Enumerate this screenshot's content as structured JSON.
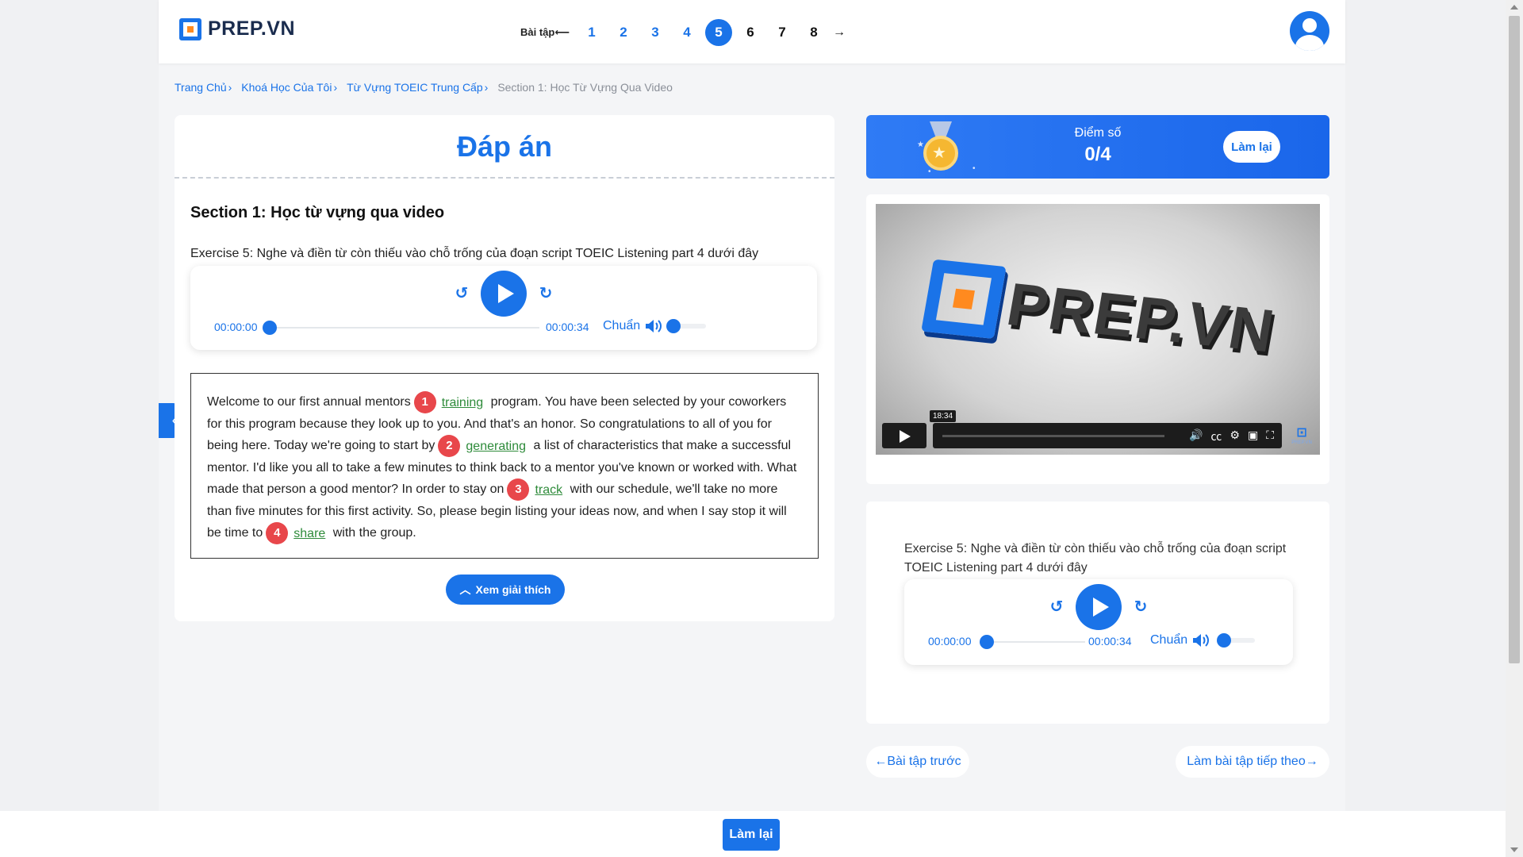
{
  "header": {
    "logo_text": "PREP.VN",
    "pager_label": "Bài tập",
    "pager_numbers": [
      "1",
      "2",
      "3",
      "4",
      "5",
      "6",
      "7",
      "8"
    ],
    "pager_arrow": "→"
  },
  "breadcrumb": {
    "items": [
      "Trang Chủ",
      "Khoá Học Của Tôi",
      "Từ Vựng TOEIC Trung Cấp"
    ],
    "current": "Section 1: Học Từ Vựng Qua Video"
  },
  "main": {
    "answer_title": "Đáp án",
    "section_title": "Section 1: Học từ vựng qua video",
    "exercise_instruction": "Exercise 5: Nghe và điền từ còn thiếu vào chỗ trống của đoạn script TOEIC Listening part 4 dưới đây",
    "audio": {
      "current_time": "00:00:00",
      "duration": "00:00:34",
      "speed": "Chuẩn"
    },
    "passage": {
      "p1": "Welcome to our first annual mentors",
      "p2": "program. You have been selected by your coworkers for this program because they look up to you. And that's an honor. So congratulations to all of you for being here. Today we're going to start by",
      "p3": "a list of characteristics that make a successful mentor. I'd like you all to take a few minutes to think back to a mentor you've known or worked with. What made that person a good mentor? In order to stay on",
      "p4": "with our schedule, we'll take no more than five minutes for this first activity. So, please begin listing your ideas now, and when I say stop it will be time to",
      "p5": "with the group.",
      "blanks": [
        {
          "num": "1",
          "word": "training"
        },
        {
          "num": "2",
          "word": "generating"
        },
        {
          "num": "3",
          "word": "track"
        },
        {
          "num": "4",
          "word": "share"
        }
      ]
    },
    "explain_button": "Xem giải thích"
  },
  "score": {
    "label": "Điểm số",
    "value": "0/4",
    "retry": "Làm lại"
  },
  "video": {
    "logo_text": "PREP.VN",
    "timestamp": "18:34",
    "brand_small": "PREP.VN"
  },
  "side_exercise": {
    "instruction": "Exercise 5: Nghe và điền từ còn thiếu vào chỗ trống của đoạn script TOEIC Listening part 4 dưới đây",
    "audio": {
      "current_time": "00:00:00",
      "duration": "00:00:34",
      "speed": "Chuẩn"
    }
  },
  "nav": {
    "prev": "←Bài tập trước",
    "next": "Làm bài tập tiếp theo→"
  },
  "footer": {
    "retry": "Làm lại"
  },
  "colors": {
    "accent": "#1a73e8",
    "answer_green": "#2e8b3a",
    "badge_red": "#e8474b"
  },
  "progress": {
    "main_audio_fraction": 0,
    "side_audio_fraction": 0,
    "video_fraction": 0
  }
}
